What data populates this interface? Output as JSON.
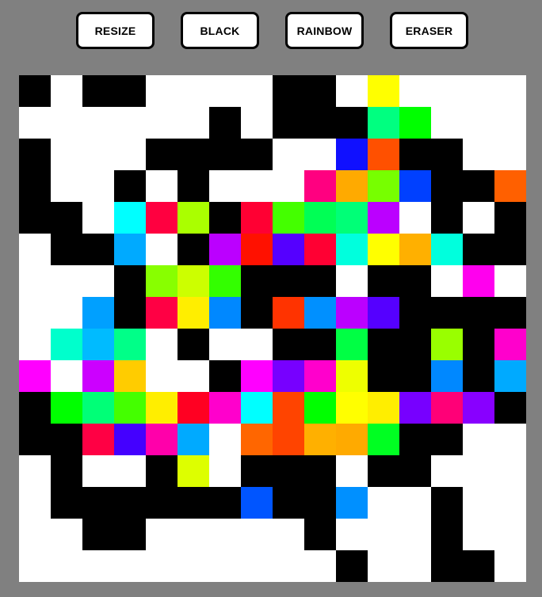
{
  "toolbar": {
    "buttons": [
      {
        "id": "resize",
        "label": "RESIZE"
      },
      {
        "id": "black",
        "label": "BLACK"
      },
      {
        "id": "rainbow",
        "label": "RAINBOW"
      },
      {
        "id": "eraser",
        "label": "ERASER"
      }
    ]
  },
  "canvas": {
    "columns": 16,
    "rows": 16,
    "palette": {
      "W": "#ffffff",
      "K": "#000000",
      "a": "#ffff00",
      "b": "#00ff80",
      "c": "#00ff00",
      "d": "#1010ff",
      "e": "#ff5000",
      "f": "#ff0080",
      "g": "#ffaa00",
      "h": "#77ff00",
      "i": "#0040ff",
      "j": "#ff6000",
      "k": "#00ffff",
      "l": "#ff0040",
      "m": "#aaff00",
      "n": "#ff0033",
      "o": "#44ff00",
      "p": "#00ff55",
      "q": "#00ff77",
      "r": "#bb00ff",
      "s": "#00aaff",
      "t": "#bb00ff",
      "u": "#ff1100",
      "v": "#5500ff",
      "w": "#00ffdd",
      "x": "#ffb000",
      "y": "#00ffdd",
      "z": "#88ff00",
      "A": "#ccff00",
      "B": "#33ff00",
      "C": "#ff00ee",
      "D": "#00a0ff",
      "E": "#ff0044",
      "F": "#ffee00",
      "G": "#0088ff",
      "H": "#ff3300",
      "I": "#0090ff",
      "J": "#bb00ff",
      "L": "#5500ff",
      "M": "#00ffcc",
      "N": "#00bbff",
      "O": "#00ff88",
      "P": "#00ff44",
      "Q": "#99ff00",
      "R": "#ff00cc",
      "S": "#ff00ff",
      "T": "#cc00ff",
      "U": "#ffcc00",
      "V": "#ff00ff",
      "X": "#7700ff",
      "Y": "#ff00cc",
      "Z": "#eeff00",
      "0": "#00ff00",
      "1": "#00ff77",
      "2": "#44ff00",
      "3": "#ffee00",
      "4": "#ff0022",
      "5": "#ff00cc",
      "6": "#00ffff",
      "7": "#ff4400",
      "8": "#00ff00",
      "9": "#ffff00",
      "!": "#7700ff",
      "@": "#ff0077",
      "#": "#8800ff",
      "$": "#ff0044",
      "%": "#4400ff",
      "^": "#ff00aa",
      "&": "#00aaff",
      "*": "#ff6600",
      "(": "#ff4400",
      ")": "#ffb000",
      "-": "#ffaa00",
      "_": "#00ff22",
      "+": "#ddff00",
      "=": "#0055ff",
      "~": "#0090ff"
    },
    "grid": [
      "KWKKWWWWKKWaWWWW",
      "WWWWWWKWKKKbcWWW",
      "KWWWKKKKWWdeKKWW",
      "KWWKWKWWWfghiKKj",
      "KKWklmKnopqrWKWK",
      "WKKsWKtuvnwaxyKK",
      "WWWKzABKKKWKKWCW",
      "WWDKEFGKHIJLKKKK",
      "WMNOWKWWKKPKKQKR",
      "SWTUWWKVXYZKKGKs",
      "K01234567893!@#K",
      "KK$%^&W*()-_KKWW",
      "WKWWK+WKKKWKKWWW",
      "WKKKKKK=KK~WWKWW",
      "WWKKWWWWWKWWWKWW",
      "WWWWWWWWWWKWWKKW"
    ]
  }
}
